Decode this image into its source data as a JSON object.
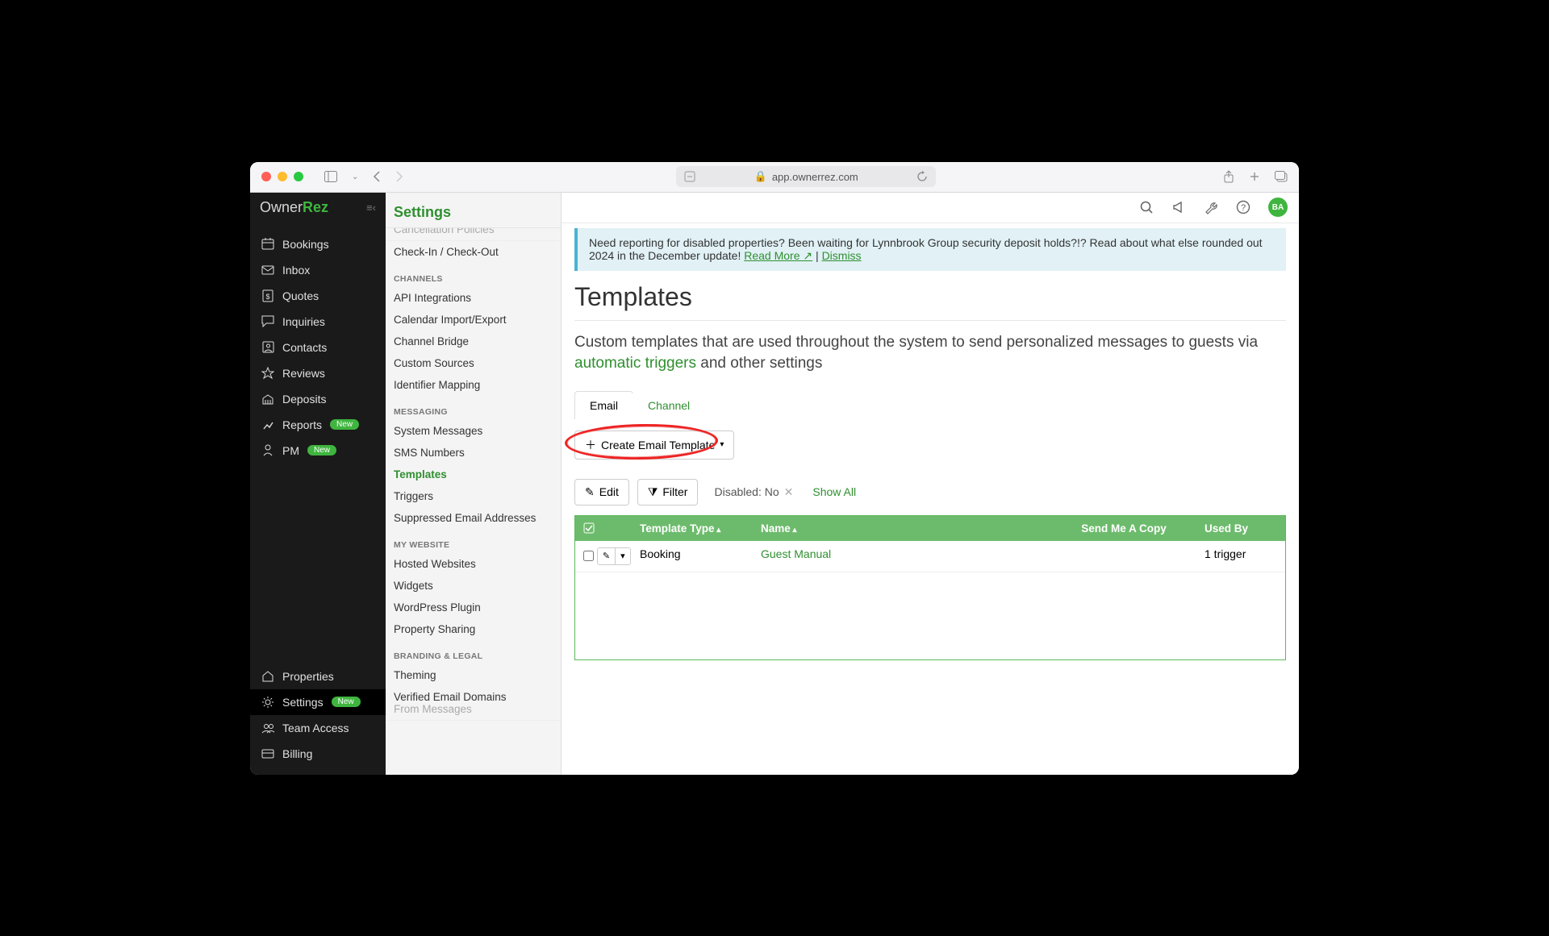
{
  "browser": {
    "url": "app.ownerrez.com"
  },
  "brand": {
    "part1": "Owner",
    "part2": "Rez"
  },
  "topIcons": {
    "avatar": "BA"
  },
  "leftNav": {
    "main": [
      {
        "key": "bookings",
        "label": "Bookings"
      },
      {
        "key": "inbox",
        "label": "Inbox"
      },
      {
        "key": "quotes",
        "label": "Quotes"
      },
      {
        "key": "inquiries",
        "label": "Inquiries"
      },
      {
        "key": "contacts",
        "label": "Contacts"
      },
      {
        "key": "reviews",
        "label": "Reviews"
      },
      {
        "key": "deposits",
        "label": "Deposits"
      },
      {
        "key": "reports",
        "label": "Reports",
        "pill": "New"
      },
      {
        "key": "pm",
        "label": "PM",
        "pill": "New"
      }
    ],
    "bottom": [
      {
        "key": "properties",
        "label": "Properties"
      },
      {
        "key": "settings",
        "label": "Settings",
        "pill": "New",
        "active": true
      },
      {
        "key": "team",
        "label": "Team Access"
      },
      {
        "key": "billing",
        "label": "Billing"
      }
    ]
  },
  "subpanel": {
    "title": "Settings",
    "groups": [
      {
        "head": null,
        "items": [
          {
            "label": "Cancellation Policies",
            "cut": true
          },
          {
            "label": "Check-In / Check-Out"
          }
        ]
      },
      {
        "head": "CHANNELS",
        "items": [
          {
            "label": "API Integrations"
          },
          {
            "label": "Calendar Import/Export"
          },
          {
            "label": "Channel Bridge"
          },
          {
            "label": "Custom Sources"
          },
          {
            "label": "Identifier Mapping"
          }
        ]
      },
      {
        "head": "MESSAGING",
        "items": [
          {
            "label": "System Messages"
          },
          {
            "label": "SMS Numbers"
          },
          {
            "label": "Templates",
            "selected": true
          },
          {
            "label": "Triggers"
          },
          {
            "label": "Suppressed Email Addresses"
          }
        ]
      },
      {
        "head": "MY WEBSITE",
        "items": [
          {
            "label": "Hosted Websites"
          },
          {
            "label": "Widgets"
          },
          {
            "label": "WordPress Plugin"
          },
          {
            "label": "Property Sharing"
          }
        ]
      },
      {
        "head": "BRANDING & LEGAL",
        "items": [
          {
            "label": "Theming"
          },
          {
            "label": "Verified Email Domains"
          },
          {
            "label": "From Messages",
            "cut": true
          }
        ]
      }
    ]
  },
  "banner": {
    "text1": "Need reporting for disabled properties? Been waiting for Lynnbrook Group security deposit holds?!? Read about what else rounded out 2024 in the December update!  ",
    "readMore": "Read More",
    "sep": " | ",
    "dismiss": "Dismiss"
  },
  "page": {
    "title": "Templates",
    "lead1": "Custom templates that are used throughout the system to send personalized messages to guests via ",
    "leadLink": "automatic triggers",
    "lead2": " and other settings"
  },
  "tabs": {
    "email": "Email",
    "channel": "Channel"
  },
  "buttons": {
    "create": "Create Email Template",
    "edit": "Edit",
    "filter": "Filter"
  },
  "filter": {
    "disabledLabel": "Disabled: No",
    "showAll": "Show All"
  },
  "table": {
    "headers": {
      "type": "Template Type",
      "name": "Name",
      "copy": "Send Me A Copy",
      "used": "Used By"
    },
    "rows": [
      {
        "type": "Booking",
        "name": "Guest Manual",
        "copy": "",
        "used": "1 trigger"
      }
    ]
  }
}
